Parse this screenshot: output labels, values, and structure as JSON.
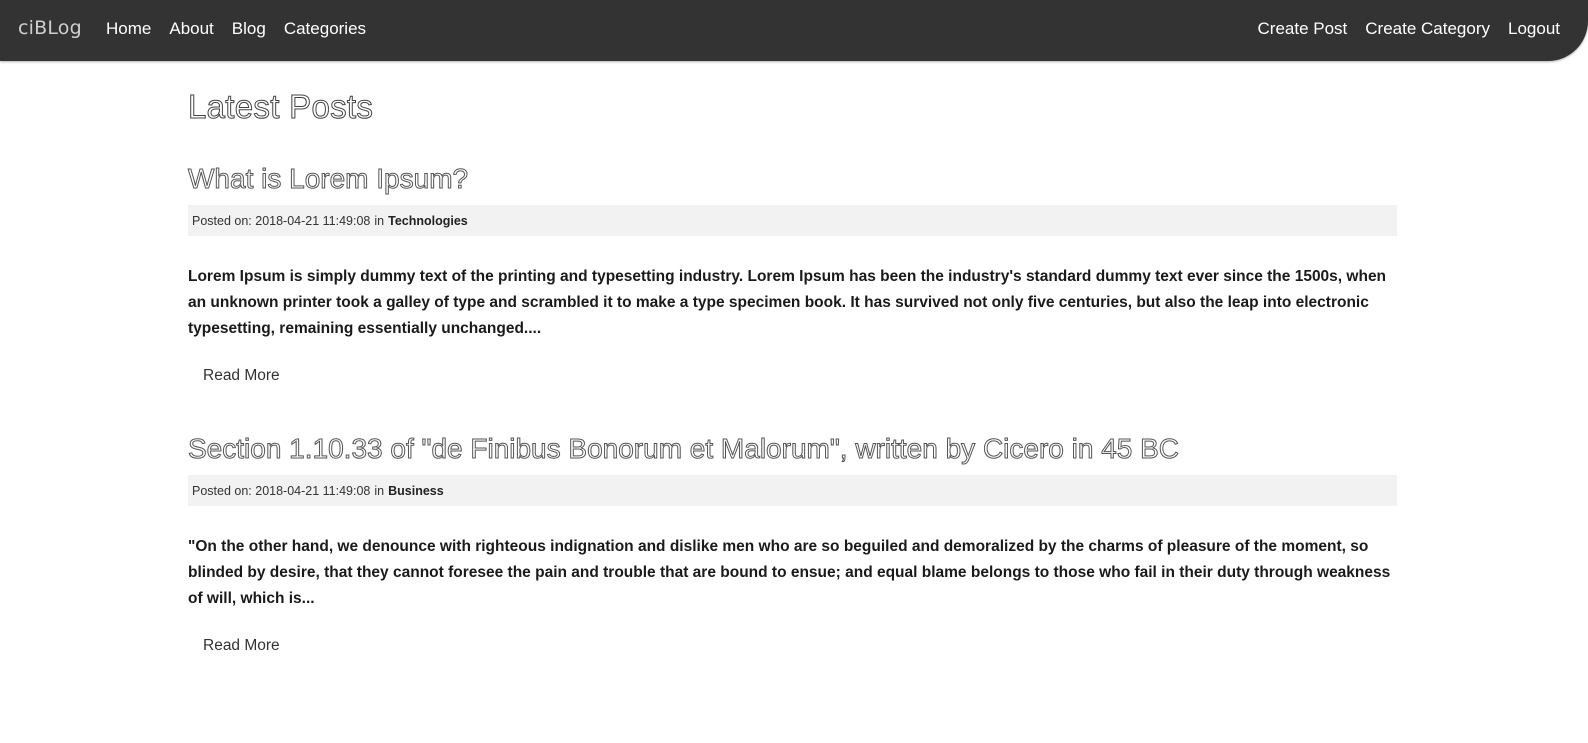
{
  "navbar": {
    "brand": "ciBLog",
    "left_links": [
      "Home",
      "About",
      "Blog",
      "Categories"
    ],
    "right_links": [
      "Create Post",
      "Create Category",
      "Logout"
    ]
  },
  "main": {
    "title": "Latest Posts",
    "posts": [
      {
        "title": "What is Lorem Ipsum?",
        "posted_prefix": "Posted on: 2018-04-21 11:49:08",
        "in_label": "in",
        "category": "Technologies",
        "excerpt": "Lorem Ipsum is simply dummy text of the printing and typesetting industry. Lorem Ipsum has been the industry's standard dummy text ever since the 1500s, when an unknown printer took a galley of type and scrambled it to make a type specimen book. It has survived not only five centuries, but also the leap into electronic typesetting, remaining essentially unchanged....",
        "read_more": "Read More"
      },
      {
        "title": "Section 1.10.33 of \"de Finibus Bonorum et Malorum\", written by Cicero in 45 BC",
        "posted_prefix": "Posted on: 2018-04-21 11:49:08",
        "in_label": "in",
        "category": "Business",
        "excerpt": "\"On the other hand, we denounce with righteous indignation and dislike men who are so beguiled and demoralized by the charms of pleasure of the moment, so blinded by desire, that they cannot foresee the pain and trouble that are bound to ensue; and equal blame belongs to those who fail in their duty through weakness of will, which is...",
        "read_more": "Read More"
      }
    ]
  }
}
